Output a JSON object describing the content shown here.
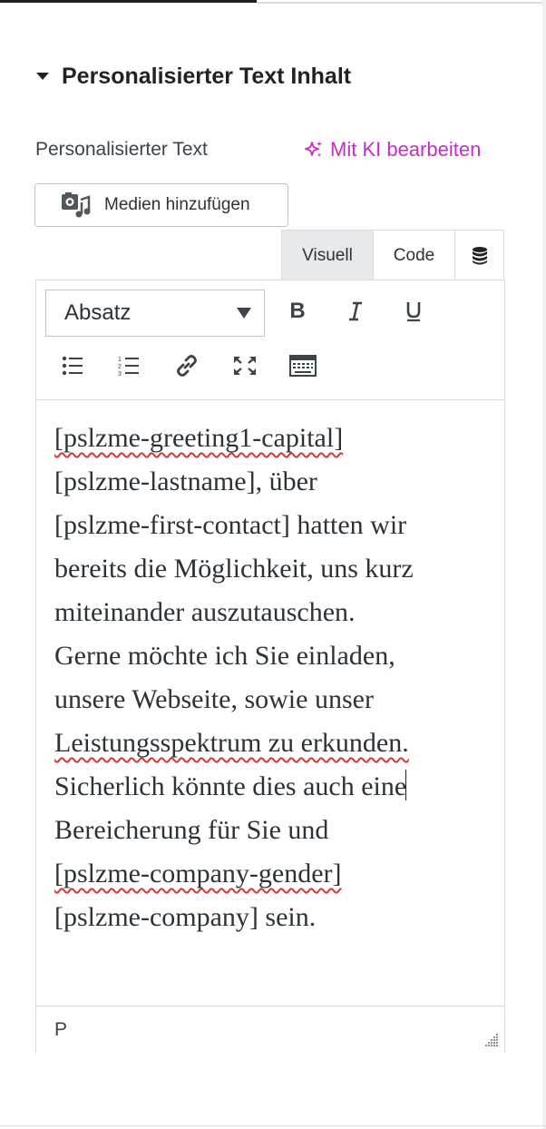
{
  "section": {
    "title": "Personalisierter Text Inhalt"
  },
  "field": {
    "label": "Personalisierter Text",
    "ai_link": "Mit KI bearbeiten"
  },
  "media_button": {
    "label": "Medien hinzufügen"
  },
  "editor_tabs": {
    "visual": "Visuell",
    "code": "Code"
  },
  "toolbar": {
    "format_value": "Absatz"
  },
  "content": {
    "lines": [
      "[pslzme-greeting1-capital]",
      "[pslzme-lastname], über",
      "[pslzme-first-contact] hatten wir",
      "bereits die Möglichkeit, uns kurz",
      "miteinander auszutauschen.",
      "Gerne möchte ich Sie einladen,",
      "unsere Webseite, sowie unser",
      "Leistungsspektrum zu erkunden.",
      "Sicherlich könnte dies auch eine",
      "Bereicherung für Sie und",
      "[pslzme-company-gender]",
      "[pslzme-company] sein."
    ]
  },
  "statusbar": {
    "path": "P"
  },
  "colors": {
    "accent_ai": "#c42ec4",
    "spellcheck": "#d63638",
    "border": "#dcdcde"
  },
  "icons": {
    "section_toggle": "triangle-down-icon",
    "ai": "sparkles-icon",
    "media": "media-icon",
    "db": "database-icon",
    "bold": "bold-icon",
    "italic": "italic-icon",
    "underline": "underline-icon",
    "bullet_list": "bullet-list-icon",
    "numbered_list": "numbered-list-icon",
    "link": "link-icon",
    "fullscreen": "fullscreen-icon",
    "toolbar_toggle": "keyboard-icon",
    "resize": "resize-handle-icon"
  }
}
